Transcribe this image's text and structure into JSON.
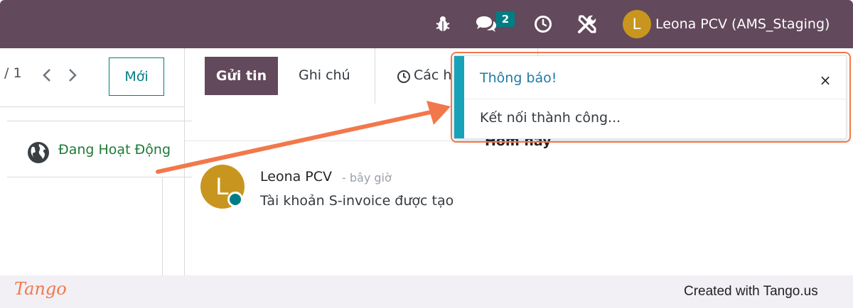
{
  "navbar": {
    "chat_badge": "2",
    "avatar_initial": "L",
    "user_name": "Leona PCV (AMS_Staging)",
    "icons": [
      "bug-icon",
      "chat-icon",
      "clock-icon",
      "tools-icon"
    ]
  },
  "pager": {
    "value": "/ 1",
    "new_button": "Mới"
  },
  "status": {
    "label": "Đang Hoạt Động",
    "color": "#1f7a37"
  },
  "chatter": {
    "send_button": "Gửi tin",
    "note_tab": "Ghi chú",
    "activity_tab": "Các h",
    "date_separator": "Hôm nay",
    "message": {
      "avatar_initial": "L",
      "author": "Leona PCV",
      "time": "- bây giờ",
      "body": "Tài khoản S-invoice được tạo"
    }
  },
  "toast": {
    "title": "Thông báo!",
    "close": "×",
    "body": "Kết nối thành công..."
  },
  "footer": {
    "logo": "Tango",
    "credit": "Created with Tango.us"
  },
  "colors": {
    "navbar": "#62495b",
    "accent": "#017e84",
    "toast_bar": "#17a2b8",
    "highlight": "#f2784b"
  }
}
